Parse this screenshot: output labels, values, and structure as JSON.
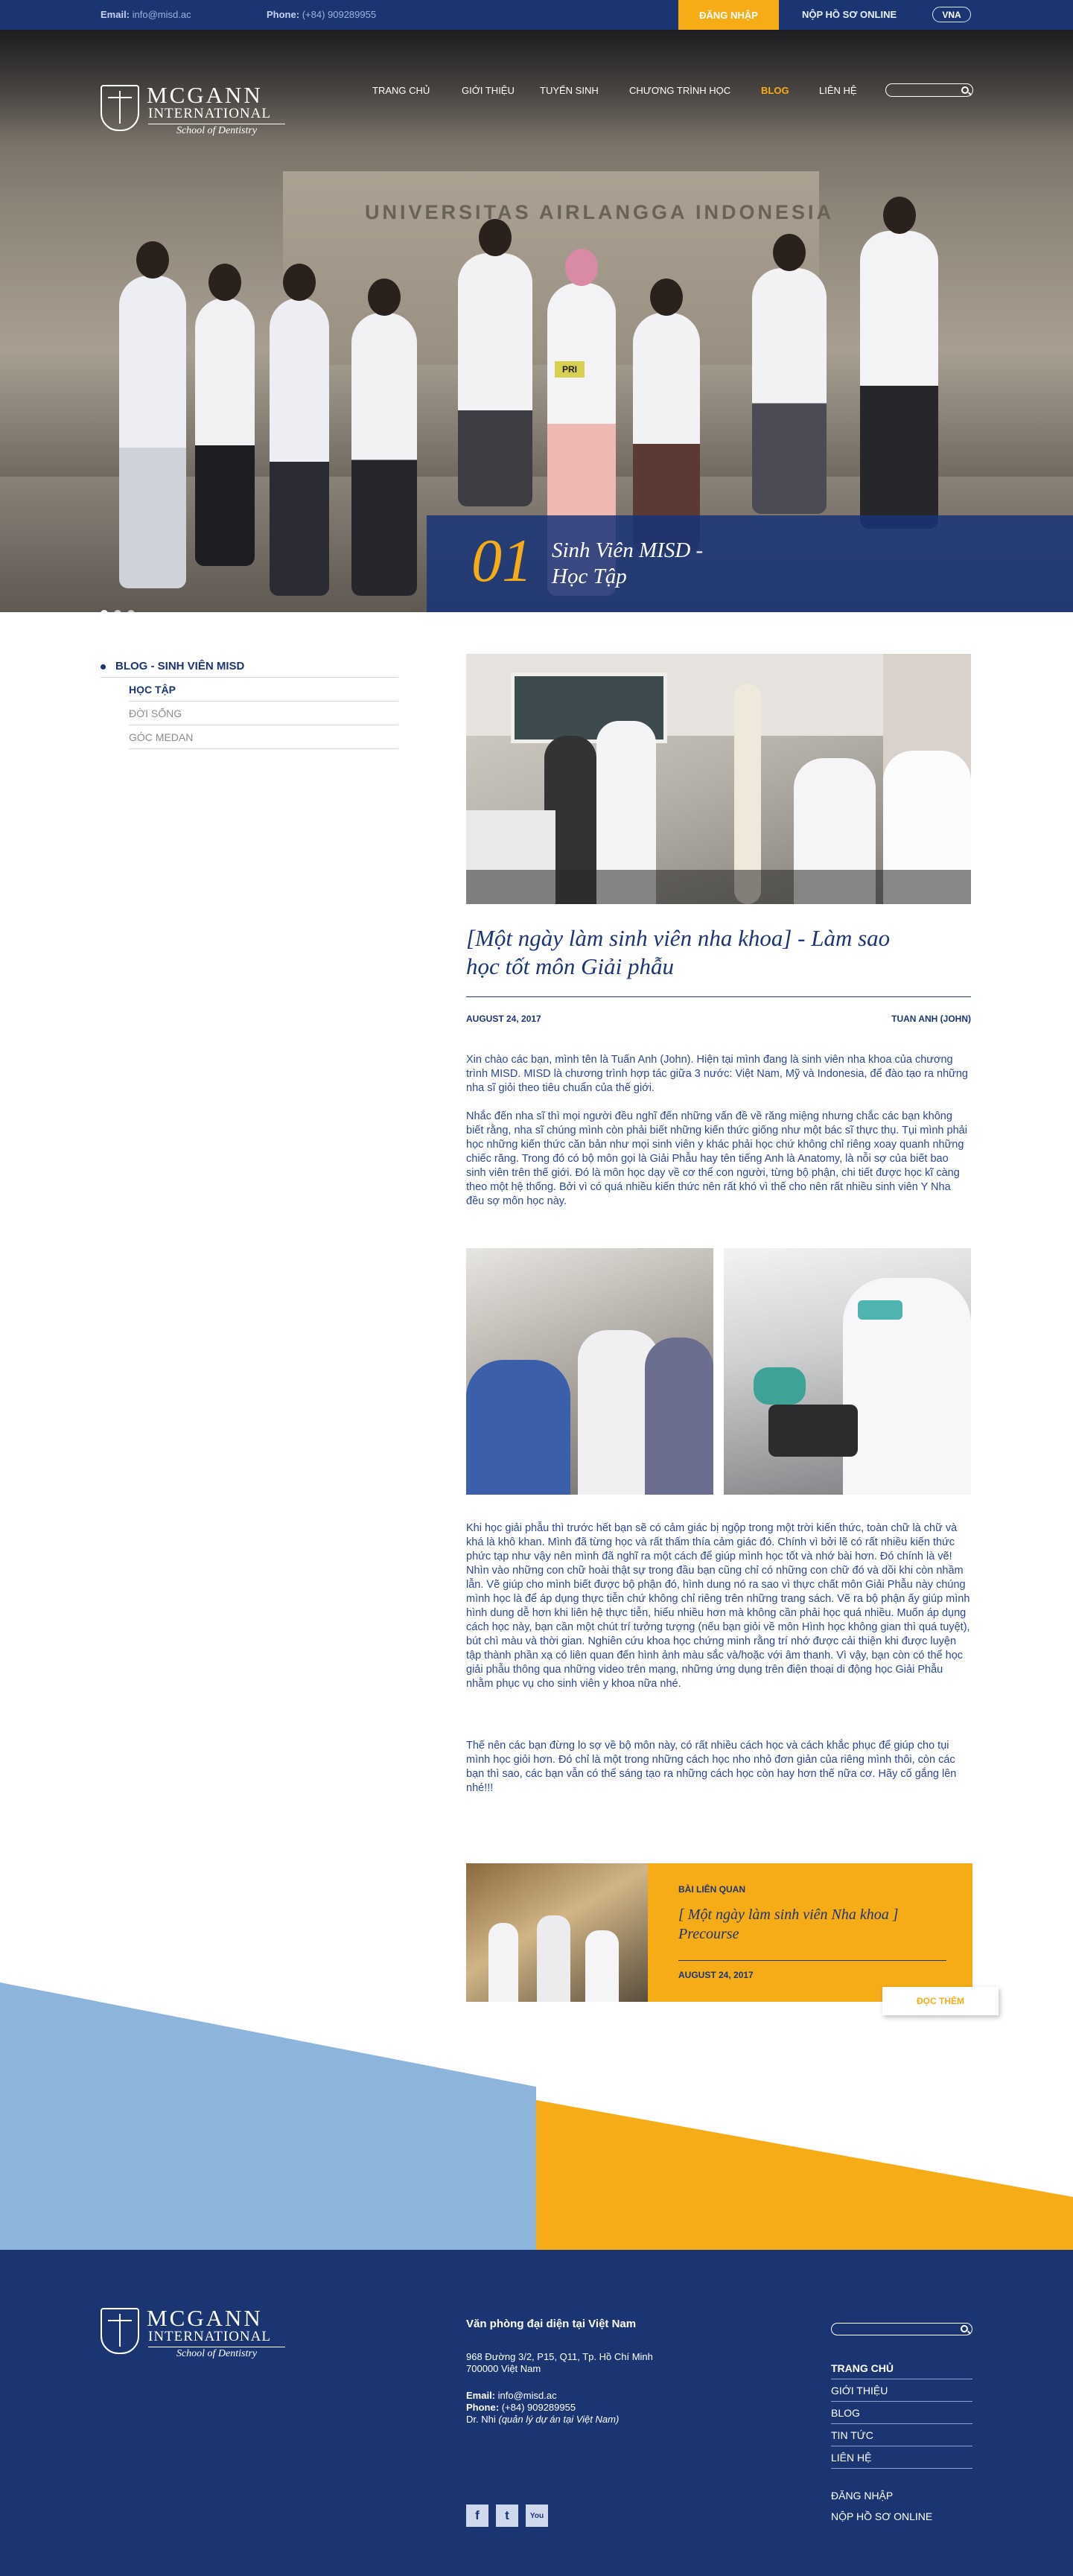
{
  "topbar": {
    "email_label": "Email:",
    "email_value": "info@misd.ac",
    "phone_label": "Phone:",
    "phone_value": "(+84) 909289955",
    "login": "ĐĂNG NHẬP",
    "apply": "NỘP HỒ SƠ ONLINE",
    "language": "VNA"
  },
  "logo": {
    "name": "MCGANN",
    "sub": "INTERNATIONAL",
    "tagline": "School of Dentistry"
  },
  "nav": {
    "items": [
      "TRANG CHỦ",
      "GIỚI THIỆU",
      "TUYỂN SINH",
      "CHƯƠNG TRÌNH HỌC",
      "BLOG",
      "LIÊN HỆ"
    ],
    "active": "BLOG"
  },
  "hero": {
    "number": "01",
    "caption": "Sinh Viên MISD - Học Tập",
    "background_text": "UNIVERSITAS AIRLANGGA INDONESIA",
    "badge_text": "PRI"
  },
  "sidebar": {
    "heading": "BLOG - SINH VIÊN MISD",
    "items": [
      "HỌC TẬP",
      "ĐỜI SỐNG",
      "GÓC MEDAN"
    ],
    "active": "HỌC TẬP"
  },
  "article": {
    "title": "[Một ngày làm sinh viên nha khoa] - Làm sao học tốt môn Giải phẫu",
    "date": "AUGUST 24, 2017",
    "author": "TUAN ANH (JOHN)",
    "p1": "Xin chào các bạn, mình tên là Tuấn Anh (John). Hiện tại mình đang là sinh viên nha khoa của chương trình MISD. MISD là chương trình hợp tác giữa 3 nước: Việt Nam, Mỹ và Indonesia, để đào tạo ra những nha sĩ giỏi theo tiêu chuẩn của thế giới.",
    "p2": "Nhắc đến nha sĩ thì mọi người đều nghĩ đến những vấn đề về răng miệng nhưng chắc các bạn không biết rằng, nha sĩ chúng mình còn phải biết những kiến thức giống như một bác sĩ thực thụ. Tụi mình phải học những kiến thức căn bản như mọi sinh viên y khác phải học chứ không chỉ riêng xoay quanh những chiếc răng. Trong đó có bộ môn gọi là Giải Phẫu hay tên tiếng Anh là Anatomy, là nỗi sợ của biết bao sinh viên trên thế giới. Đó là môn học dạy về cơ thể con người, từng bộ phận, chi tiết được học kĩ càng theo một hệ thống. Bởi vì có quá nhiều kiến thức nên rất khó vì thế cho nên rất nhiều sinh viên Y Nha đều sợ môn học này.",
    "p3": "Khi học giải phẫu thì trước hết bạn sẽ có cảm giác bị ngộp trong một trời kiến thức, toàn chữ là chữ và khá là khô khan. Mình đã từng học và rất thấm thía cảm giác đó. Chính vì bởi lẽ có rất nhiều kiến thức phức tạp như vậy nên mình đã nghĩ ra một cách để giúp mình học tốt và nhớ bài hơn. Đó chính là vẽ! Nhìn vào những con chữ hoài thật sự trong đầu bạn cũng chỉ có những con chữ đó và dồi khi còn nhầm lẫn. Vẽ giúp cho mình biết được bộ phận đó, hình dung nó ra sao vì thực chất môn Giải Phẫu này chúng mình học là để áp dụng thực tiễn chứ không chỉ riêng trên những trang sách. Vẽ ra bộ phận ấy giúp mình hình dung dễ hơn khi liên hệ thực tiễn, hiểu nhiều hơn mà không cần phải học quá nhiều. Muốn áp dụng cách học này, bạn cần một chút trí tưởng tượng (nếu bạn giỏi về môn Hình học không gian thì quá tuyệt), bút chì màu và thời gian. Nghiên cứu khoa học chứng minh rằng trí nhớ được cải thiện khi được luyện tập thành phần xạ có liên quan đến hình ảnh  màu sắc và/hoặc với âm thanh. Vì vậy, bạn còn có thể học giải phẫu thông qua những video trên mạng, những ứng dụng trên điện thoại di động học Giải Phẫu nhằm phục vụ cho sinh viên y khoa nữa nhé.",
    "p4": "Thế nên các bạn đừng lo sợ về bộ môn này, có rất nhiều cách học và cách khắc phục để giúp cho tụi mình học giỏi hơn. Đó chỉ là một trong những cách học nho nhỏ đơn giản của riêng mình thôi, còn các bạn thì sao, các bạn vẫn có thể sáng tạo ra những cách học còn hay hơn thế nữa cơ. Hãy cố gắng lên nhé!!!"
  },
  "related": {
    "label": "BÀI LIÊN QUAN",
    "title": "[ Một ngày làm sinh viên Nha khoa ] Precourse",
    "date": "AUGUST 24, 2017",
    "more": "ĐỌC THÊM"
  },
  "footer": {
    "office_heading": "Văn phòng đại diện tại Việt Nam",
    "address_line1": "968 Đường 3/2, P15, Q11, Tp. Hồ Chí Minh",
    "address_line2": "700000 Việt Nam",
    "email_label": "Email:",
    "email_value": "info@misd.ac",
    "phone_label": "Phone:",
    "phone_value": "(+84) 909289955",
    "contact_name": "Dr. Nhi",
    "contact_role": "(quản lý dự án tại Việt Nam)",
    "links": [
      "TRANG CHỦ",
      "GIỚI THIỆU",
      "BLOG",
      "TIN TỨC",
      "LIÊN HỆ"
    ],
    "active": "TRANG CHỦ",
    "login": "ĐĂNG NHẬP",
    "apply": "NỘP HỒ SƠ ONLINE"
  },
  "social": {
    "facebook": "f",
    "twitter": "t",
    "youtube": "You"
  },
  "colors": {
    "navy": "#1b3573",
    "accent": "#f6ac16",
    "light_blue": "#8db5dc"
  }
}
